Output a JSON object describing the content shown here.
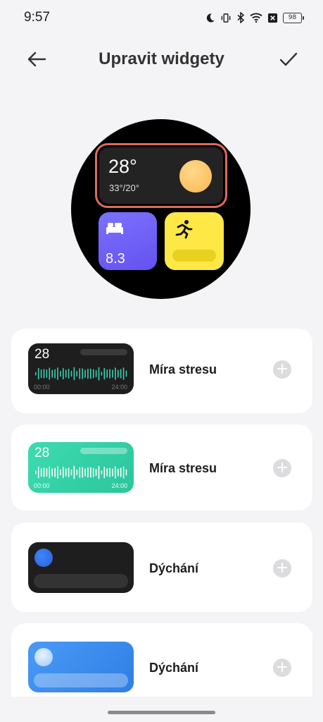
{
  "status_bar": {
    "time": "9:57",
    "battery": "98",
    "icons": [
      "moon-icon",
      "vibrate-icon",
      "bluetooth-icon",
      "wifi-icon",
      "no-sim-icon",
      "battery-icon"
    ]
  },
  "header": {
    "title": "Upravit widgety",
    "back_icon": "arrow-left-icon",
    "confirm_icon": "check-icon"
  },
  "watch_preview": {
    "weather": {
      "temp": "28°",
      "range": "33°/20°"
    },
    "sleep": {
      "value": "8.3",
      "icon": "bed-icon"
    },
    "activity": {
      "icon": "running-icon"
    }
  },
  "widgets": [
    {
      "label": "Míra stresu",
      "value": "28",
      "time_start": "00:00",
      "time_end": "24:00",
      "style": "dark"
    },
    {
      "label": "Míra stresu",
      "value": "28",
      "time_start": "00:00",
      "time_end": "24:00",
      "style": "green"
    },
    {
      "label": "Dýchání",
      "style": "dark"
    },
    {
      "label": "Dýchání",
      "style": "blue"
    }
  ],
  "add_icon": "plus-icon",
  "colors": {
    "selected_border": "#e06a55",
    "sleep_tile": "#6e5ff5",
    "activity_tile": "#fde845",
    "stress_dark_wave": "#3ad1b0",
    "stress_green_bg": "#36d3a5",
    "breath_blue_bg": "#3a8cf0"
  }
}
